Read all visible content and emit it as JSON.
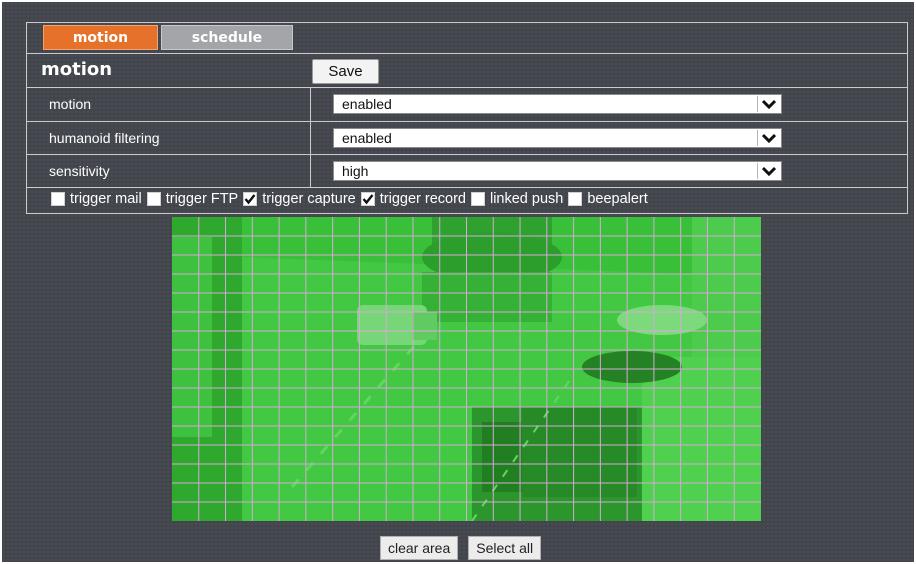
{
  "tabs": [
    {
      "label": "motion",
      "active": true
    },
    {
      "label": "schedule",
      "active": false
    }
  ],
  "section": {
    "title": "motion",
    "save_label": "Save"
  },
  "settings": [
    {
      "label": "motion",
      "value": "enabled"
    },
    {
      "label": "humanoid filtering",
      "value": "enabled"
    },
    {
      "label": "sensitivity",
      "value": "high"
    }
  ],
  "options": [
    {
      "label": "trigger mail",
      "checked": false
    },
    {
      "label": "trigger FTP",
      "checked": false
    },
    {
      "label": "trigger capture",
      "checked": true
    },
    {
      "label": "trigger record",
      "checked": true
    },
    {
      "label": "linked push",
      "checked": false
    },
    {
      "label": "beepalert",
      "checked": false
    }
  ],
  "grid": {
    "columns": 22,
    "rows": 16,
    "overlay_color": "#2fc22f",
    "line_color": "#d7a9d7"
  },
  "buttons": {
    "clear_label": "clear area",
    "select_all_label": "Select all"
  },
  "colors": {
    "accent": "#e5712a",
    "background": "#42464c",
    "tab_inactive": "#a3a5a8"
  }
}
